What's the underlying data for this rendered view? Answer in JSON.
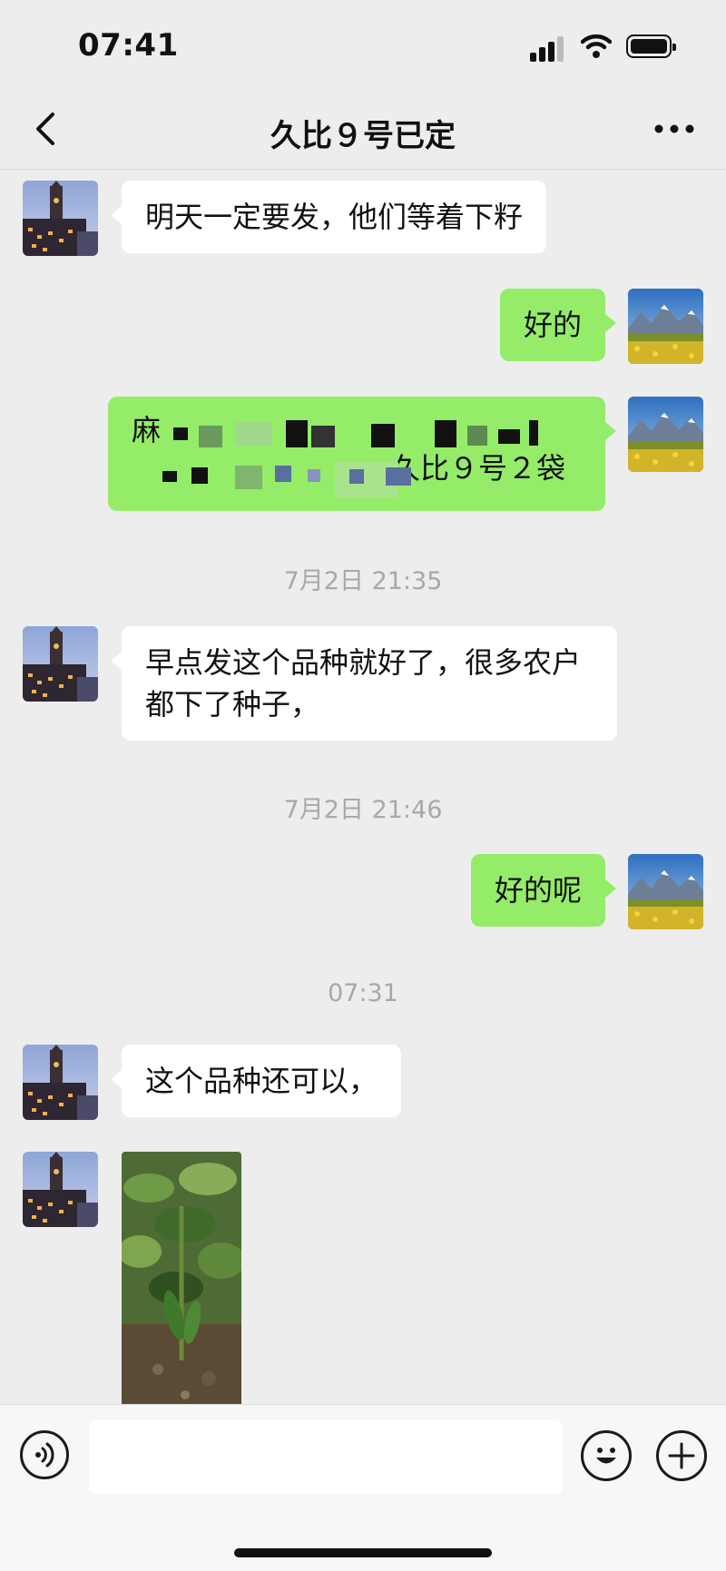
{
  "status_bar": {
    "time": "07:41"
  },
  "header": {
    "title": "久比９号已定"
  },
  "messages": [
    {
      "text": "明天一定要发，他们等着下籽"
    },
    {
      "text": "好的"
    },
    {
      "text_line1": "麻",
      "text_line2": "久比９号２袋"
    },
    {
      "timestamp": "7月2日 21:35"
    },
    {
      "text": "早点发这个品种就好了，很多农户都下了种子，"
    },
    {
      "timestamp": "7月2日 21:46"
    },
    {
      "text": "好的呢"
    },
    {
      "timestamp": "07:31"
    },
    {
      "text": "这个品种还可以，"
    }
  ],
  "input": {
    "placeholder": ""
  },
  "colors": {
    "outgoing_bubble": "#95ec69",
    "incoming_bubble": "#ffffff",
    "background": "#ededed"
  }
}
